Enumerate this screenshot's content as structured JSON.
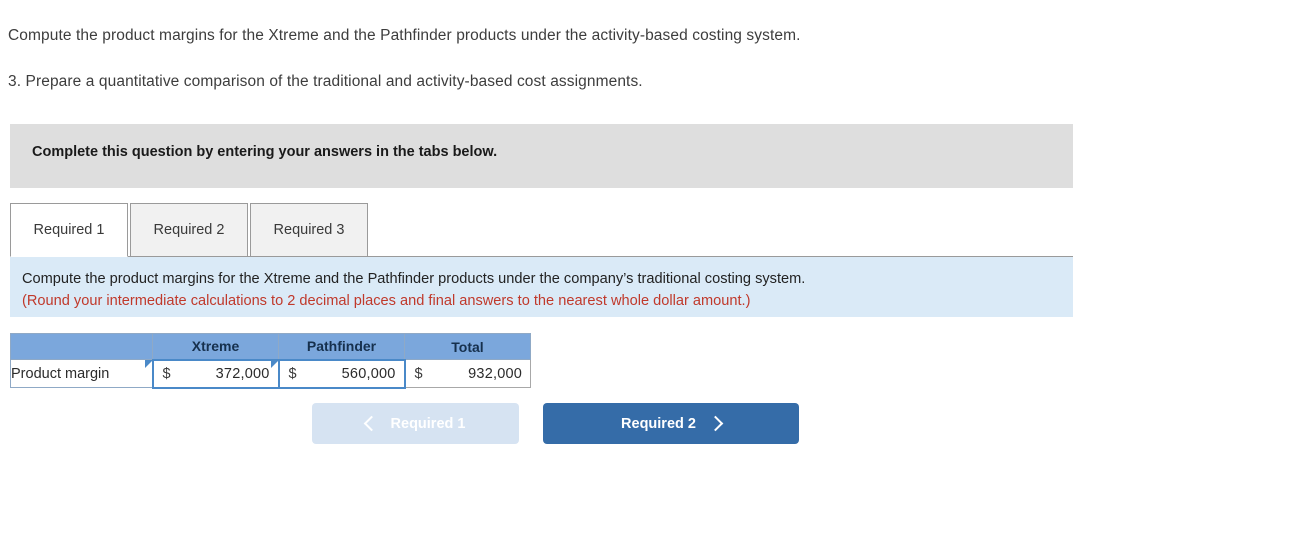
{
  "intro": {
    "line1": "Compute the product margins for the Xtreme and the Pathfinder products under the activity-based costing system.",
    "line2": "3. Prepare a quantitative comparison of the traditional and activity-based cost assignments."
  },
  "banner": {
    "text": "Complete this question by entering your answers in the tabs below."
  },
  "tabs": [
    {
      "label": "Required 1",
      "active": true
    },
    {
      "label": "Required 2",
      "active": false
    },
    {
      "label": "Required 3",
      "active": false
    }
  ],
  "question": {
    "line1": "Compute the product margins for the Xtreme and the Pathfinder products under the company’s traditional costing system.",
    "line2": "(Round your intermediate calculations to 2 decimal places and final answers to the nearest whole dollar amount.)"
  },
  "table": {
    "headers": [
      "",
      "Xtreme",
      "Pathfinder",
      "Total"
    ],
    "rows": [
      {
        "label": "Product margin",
        "cells": [
          {
            "symbol": "$",
            "amount": "372,000",
            "editable": true
          },
          {
            "symbol": "$",
            "amount": "560,000",
            "editable": true
          },
          {
            "symbol": "$",
            "amount": "932,000",
            "editable": false
          }
        ]
      }
    ]
  },
  "nav": {
    "prev_label": "Required 1",
    "next_label": "Required 2",
    "prev_icon": "chevron-left-icon",
    "next_icon": "chevron-right-icon"
  },
  "colors": {
    "banner_bg": "#dedede",
    "question_bg": "#daeaf7",
    "question_warning": "#c0392b",
    "table_header_bg": "#7ba7dc",
    "input_border": "#4a89c8",
    "btn_next_bg": "#356ca8",
    "btn_prev_bg": "#d6e3f2"
  }
}
